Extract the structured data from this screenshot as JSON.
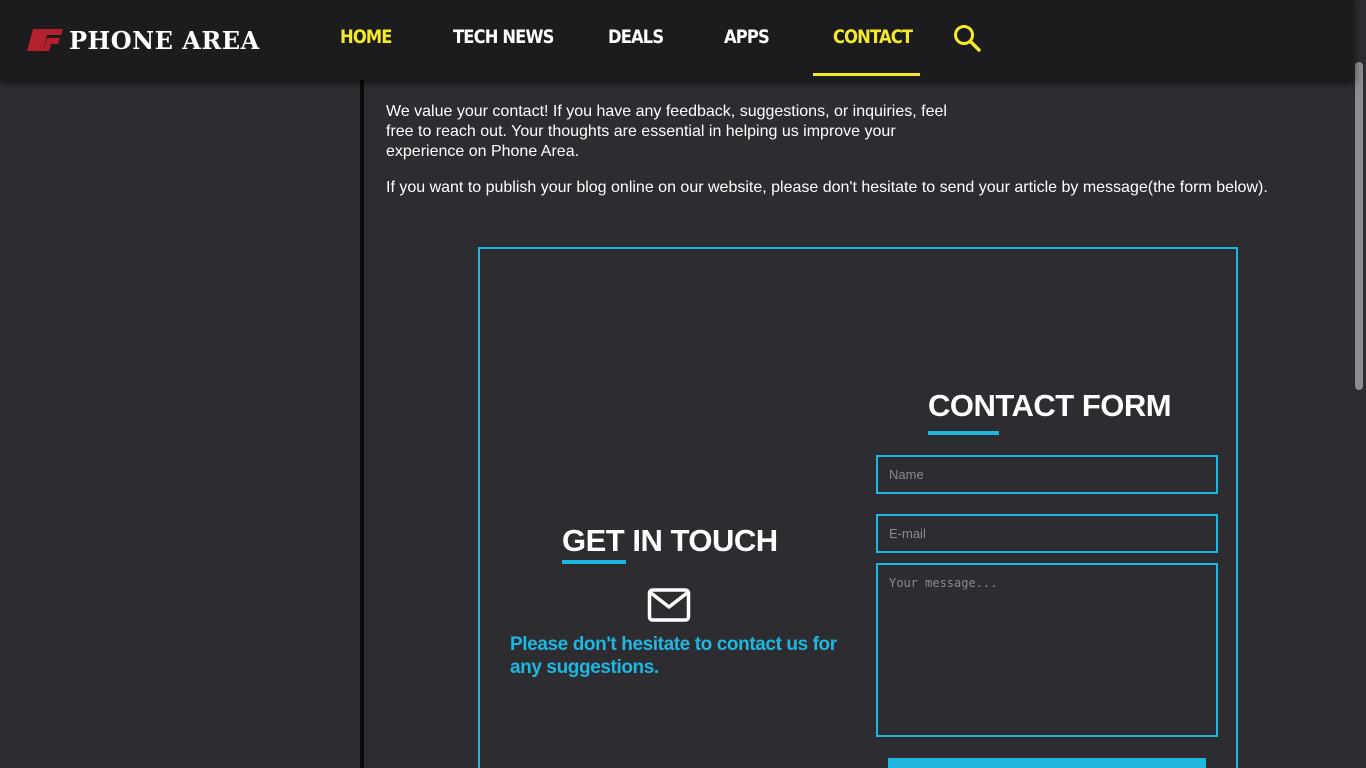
{
  "header": {
    "logo_text": "PHONE AREA",
    "nav": [
      {
        "label": "HOME"
      },
      {
        "label": "TECH NEWS"
      },
      {
        "label": "DEALS"
      },
      {
        "label": "APPS"
      },
      {
        "label": "CONTACT"
      }
    ],
    "active": "CONTACT",
    "search_icon": "search-icon"
  },
  "intro": {
    "paragraph1": "We value your contact! If you have any feedback, suggestions, or inquiries, feel free to reach out. Your thoughts are essential in helping us improve your experience on Phone Area.",
    "paragraph2": "If you want to publish your blog online on our website, please don't hesitate to send your article by message(the form below)."
  },
  "get_in_touch": {
    "title": "GET IN TOUCH",
    "icon": "mail-icon",
    "text": "Please don't hesitate to contact us for any suggestions."
  },
  "contact_form": {
    "title": "CONTACT FORM",
    "name_placeholder": "Name",
    "email_placeholder": "E-mail",
    "message_placeholder": "Your message..."
  },
  "colors": {
    "background": "#2d2c31",
    "navbar": "#1c1c1f",
    "accent": "#1fb6e0",
    "nav_highlight": "#f5ea2a",
    "logo_red": "#b5202e"
  }
}
